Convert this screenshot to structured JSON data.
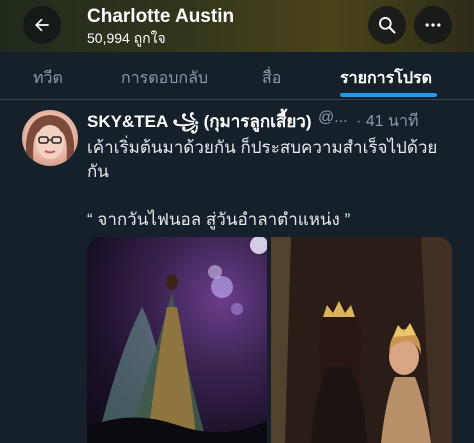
{
  "header": {
    "title": "Charlotte Austin",
    "subtitle": "50,994 ถูกใจ"
  },
  "tabs": [
    {
      "label": "ทวีต"
    },
    {
      "label": "การตอบกลับ"
    },
    {
      "label": "สื่อ"
    },
    {
      "label": "รายการโปรด"
    }
  ],
  "tweet": {
    "author": "SKY&TEA ꧁ (กุมารลูกเสี้ยว)",
    "handle": "@...",
    "time": "· 41 นาที",
    "text_line1": "เค้าเริ่มต้นมาด้วยกัน ก็ประสบความสำเร็จไปด้วย",
    "text_line2": "กัน",
    "text_line3": "“ จากวันไฟนอล สู่วันอำลาตำแหน่ง ”"
  },
  "colors": {
    "background": "#15202b",
    "accent": "#1d9bf0",
    "secondary_text": "#8b98a5"
  },
  "icons": {
    "back": "arrow-left-icon",
    "search": "search-icon",
    "more": "more-horizontal-icon"
  }
}
